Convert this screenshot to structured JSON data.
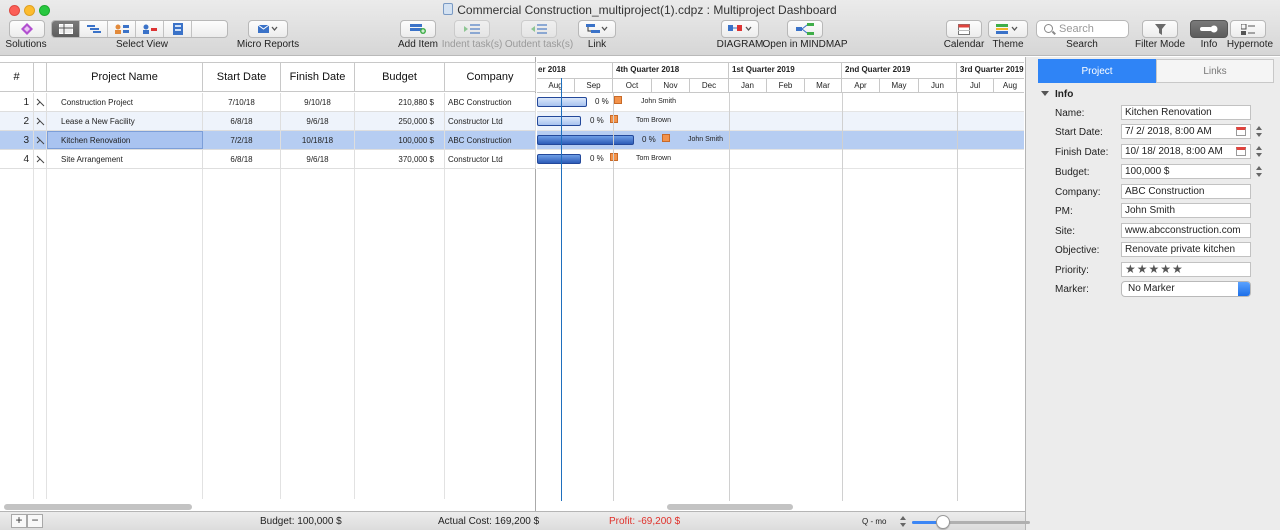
{
  "window": {
    "title": "Commercial Construction_multiproject(1).cdpz : Multiproject Dashboard"
  },
  "toolbar": {
    "solutions": "Solutions",
    "select_view": "Select View",
    "micro_reports": "Micro Reports",
    "add_item": "Add Item",
    "indent": "Indent task(s)",
    "outdent": "Outdent task(s)",
    "link": "Link",
    "diagram": "DIAGRAM",
    "mindmap": "Open in MINDMAP",
    "calendar": "Calendar",
    "theme": "Theme",
    "search_label": "Search",
    "search_placeholder": "Search",
    "filter_mode": "Filter Mode",
    "info": "Info",
    "hypernote": "Hypernote"
  },
  "table": {
    "headers": {
      "num": "#",
      "name": "Project Name",
      "start": "Start Date",
      "finish": "Finish Date",
      "budget": "Budget",
      "company": "Company"
    },
    "rows": [
      {
        "num": "1",
        "name": "Construction Project",
        "start": "7/10/18",
        "finish": "9/10/18",
        "budget": "210,880 $",
        "company": "ABC Construction"
      },
      {
        "num": "2",
        "name": "Lease a New Facility",
        "start": "6/8/18",
        "finish": "9/6/18",
        "budget": "250,000 $",
        "company": "Constructor Ltd"
      },
      {
        "num": "3",
        "name": "Kitchen Renovation",
        "start": "7/2/18",
        "finish": "10/18/18",
        "budget": "100,000 $",
        "company": "ABC Construction"
      },
      {
        "num": "4",
        "name": "Site Arrangement",
        "start": "6/8/18",
        "finish": "9/6/18",
        "budget": "370,000 $",
        "company": "Constructor Ltd"
      }
    ]
  },
  "gantt": {
    "quarters": [
      "er 2018",
      "4th Quarter 2018",
      "1st Quarter 2019",
      "2nd Quarter 2019",
      "3rd Quarter 2019"
    ],
    "months": [
      "Aug",
      "Sep",
      "Oct",
      "Nov",
      "Dec",
      "Jan",
      "Feb",
      "Mar",
      "Apr",
      "May",
      "Jun",
      "Jul",
      "Aug"
    ],
    "rows": [
      {
        "pct": "0 %",
        "pm": "John Smith"
      },
      {
        "pct": "0 %",
        "pm": "Tom Brown"
      },
      {
        "pct": "0 %",
        "pm": "John Smith"
      },
      {
        "pct": "0 %",
        "pm": "Tom Brown"
      }
    ]
  },
  "panel": {
    "tabs": {
      "project": "Project",
      "links": "Links"
    },
    "section": "Info",
    "labels": {
      "name": "Name:",
      "start": "Start Date:",
      "finish": "Finish Date:",
      "budget": "Budget:",
      "company": "Company:",
      "pm": "PM:",
      "site": "Site:",
      "objective": "Objective:",
      "priority": "Priority:",
      "marker": "Marker:"
    },
    "values": {
      "name": "Kitchen Renovation",
      "start": "7/ 2/ 2018,   8:00 AM",
      "finish": "10/ 18/ 2018,   8:00 AM",
      "budget": "100,000 $",
      "company": "ABC Construction",
      "pm": "John Smith",
      "site": "www.abcconstruction.com",
      "objective": "Renovate private kitchen",
      "priority": "★★★★★",
      "marker": "No Marker"
    }
  },
  "status": {
    "budget": "Budget: 100,000 $",
    "actual": "Actual Cost: 169,200 $",
    "profit": "Profit: -69,200 $",
    "zoom": "Q - mo",
    "profit_color": "#e0302a"
  }
}
